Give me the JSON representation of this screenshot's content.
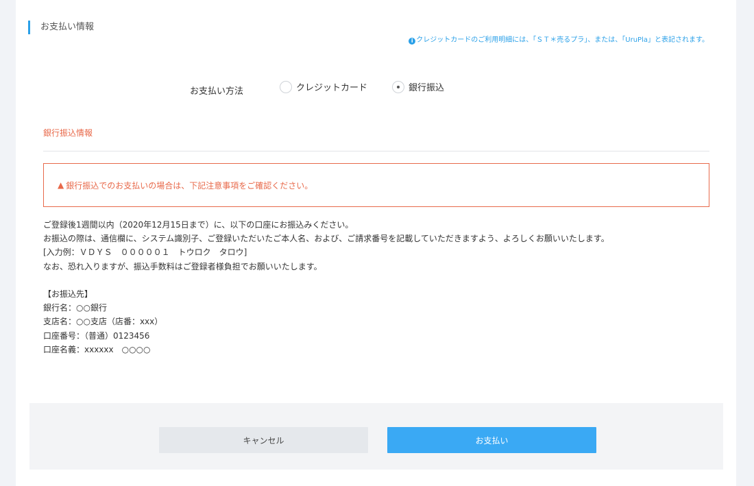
{
  "section": {
    "title": "お支払い情報",
    "credit_note": "クレジットカードのご利用明細には、「ＳＴ＊売るプラ」、または、「UruPla」と表記されます。"
  },
  "payment_method": {
    "label": "お支払い方法",
    "options": [
      {
        "label": "クレジットカード",
        "selected": false
      },
      {
        "label": "銀行振込",
        "selected": true
      }
    ]
  },
  "bank_info": {
    "title": "銀行振込情報",
    "warning": "銀行振込でのお支払いの場合は、下記注意事項をご確認ください。",
    "instructions": [
      "ご登録後1週間以内（2020年12月15日まで）に、以下の口座にお振込みください。",
      "お振込の際は、通信欄に、システム識別子、ご登録いただいたご本人名、および、ご請求番号を記載していただきますよう、よろしくお願いいたします。",
      "[入力例：ＶＤＹＳ　０００００１　トウロク　タロウ]",
      "なお、恐れ入りますが、振込手数料はご登録者様負担でお願いいたします。"
    ],
    "destination": [
      "【お振込先】",
      "銀行名：○○銀行",
      "支店名：○○支店（店番：xxx）",
      "口座番号：（普通）0123456",
      "口座名義：xxxxxx　○○○○"
    ]
  },
  "buttons": {
    "cancel": "キャンセル",
    "pay": "お支払い"
  },
  "colors": {
    "accent": "#3aa9f4",
    "warning": "#e8694a"
  },
  "icons": {
    "info": "info-icon",
    "warning": "warning-triangle-icon"
  }
}
